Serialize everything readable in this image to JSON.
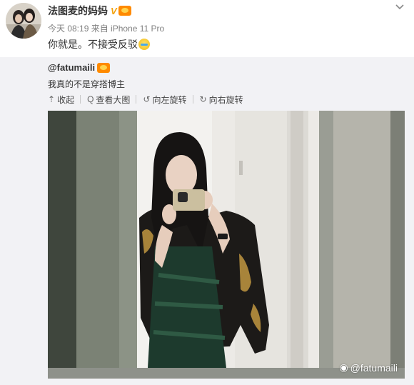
{
  "post": {
    "author": "法图麦的妈妈",
    "verify_mark": "V",
    "meta": "今天 08:19 来自 iPhone 11 Pro",
    "text": "你就是。不接受反驳"
  },
  "repost": {
    "author": "@fatumaili",
    "text": "我真的不是穿搭博主",
    "toolbar": [
      {
        "label": "收起",
        "icon": "collapse-icon",
        "glyph": "⇡"
      },
      {
        "label": "查看大图",
        "icon": "search-icon",
        "glyph": "Q"
      },
      {
        "label": "向左旋转",
        "icon": "rotate-left-icon",
        "glyph": "↺"
      },
      {
        "label": "向右旋转",
        "icon": "rotate-right-icon",
        "glyph": "↻"
      }
    ],
    "watermark": "@fatumaili"
  },
  "colors": {
    "accent_badge": "#ff8a00",
    "verify": "#f2a20c",
    "repost_bg": "#f2f2f5"
  }
}
